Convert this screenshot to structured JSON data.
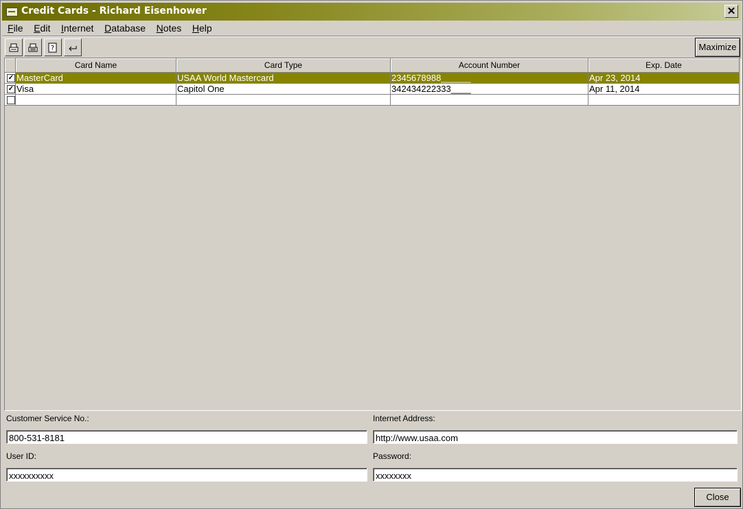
{
  "window": {
    "title": "Credit Cards - Richard Eisenhower"
  },
  "menu": [
    {
      "accel": "F",
      "rest": "ile"
    },
    {
      "accel": "E",
      "rest": "dit"
    },
    {
      "accel": "I",
      "rest": "nternet"
    },
    {
      "accel": "D",
      "rest": "atabase"
    },
    {
      "accel": "N",
      "rest": "otes"
    },
    {
      "accel": "H",
      "rest": "elp"
    }
  ],
  "toolbar": {
    "icons": [
      "print-icon",
      "print-preview-icon",
      "help-icon",
      "back-arrow-icon"
    ],
    "maximize_label": "Maximize"
  },
  "grid": {
    "columns": [
      "Card Name",
      "Card Type",
      "Account Number",
      "Exp. Date"
    ],
    "rows": [
      {
        "checked": true,
        "selected": true,
        "cells": [
          "MasterCard",
          "USAA World Mastercard",
          "2345678988______",
          "Apr 23, 2014"
        ]
      },
      {
        "checked": true,
        "selected": false,
        "cells": [
          "Visa",
          "Capitol One",
          "342434222333____",
          "Apr 11, 2014"
        ]
      },
      {
        "checked": false,
        "selected": false,
        "cells": [
          "",
          "",
          "",
          ""
        ]
      }
    ]
  },
  "details": {
    "customer_service_label": "Customer Service No.:",
    "customer_service_value": "800-531-8181",
    "internet_address_label": "Internet Address:",
    "internet_address_value": "http://www.usaa.com",
    "user_id_label": "User ID:",
    "user_id_value": "xxxxxxxxxx",
    "password_label": "Password:",
    "password_value": "xxxxxxxx"
  },
  "footer": {
    "close_label": "Close"
  },
  "colors": {
    "selection": "#878400",
    "title_start": "#6b6b00",
    "title_end": "#c6cc98"
  }
}
